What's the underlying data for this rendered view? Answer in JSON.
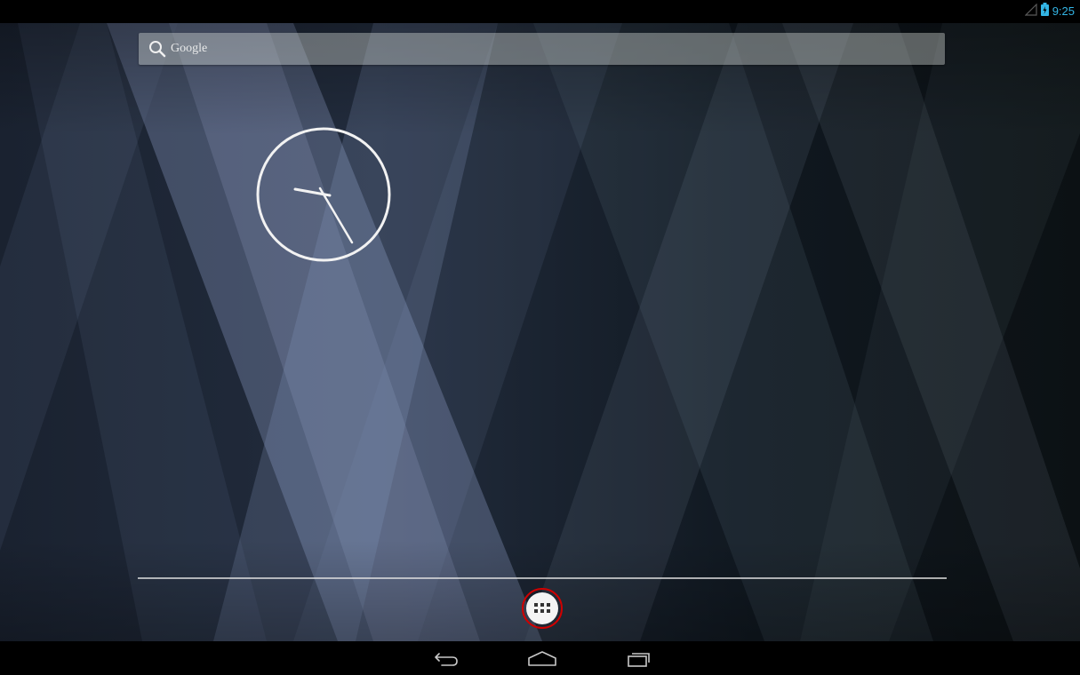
{
  "status_bar": {
    "time": "9:25",
    "icons": [
      "signal-icon",
      "battery-icon"
    ],
    "time_color": "#33b5e5"
  },
  "search": {
    "logo_text": "Google",
    "icon": "search-icon"
  },
  "clock": {
    "type": "analog",
    "time_shown": "9:25"
  },
  "dock": {
    "all_apps_icon": "all-apps-icon",
    "highlight_color": "#d00000"
  },
  "nav_bar": {
    "buttons": [
      "back-icon",
      "home-icon",
      "recent-apps-icon"
    ]
  },
  "colors": {
    "wallpaper_dark": "#0b1118",
    "wallpaper_beam": "#8ea0c8"
  }
}
